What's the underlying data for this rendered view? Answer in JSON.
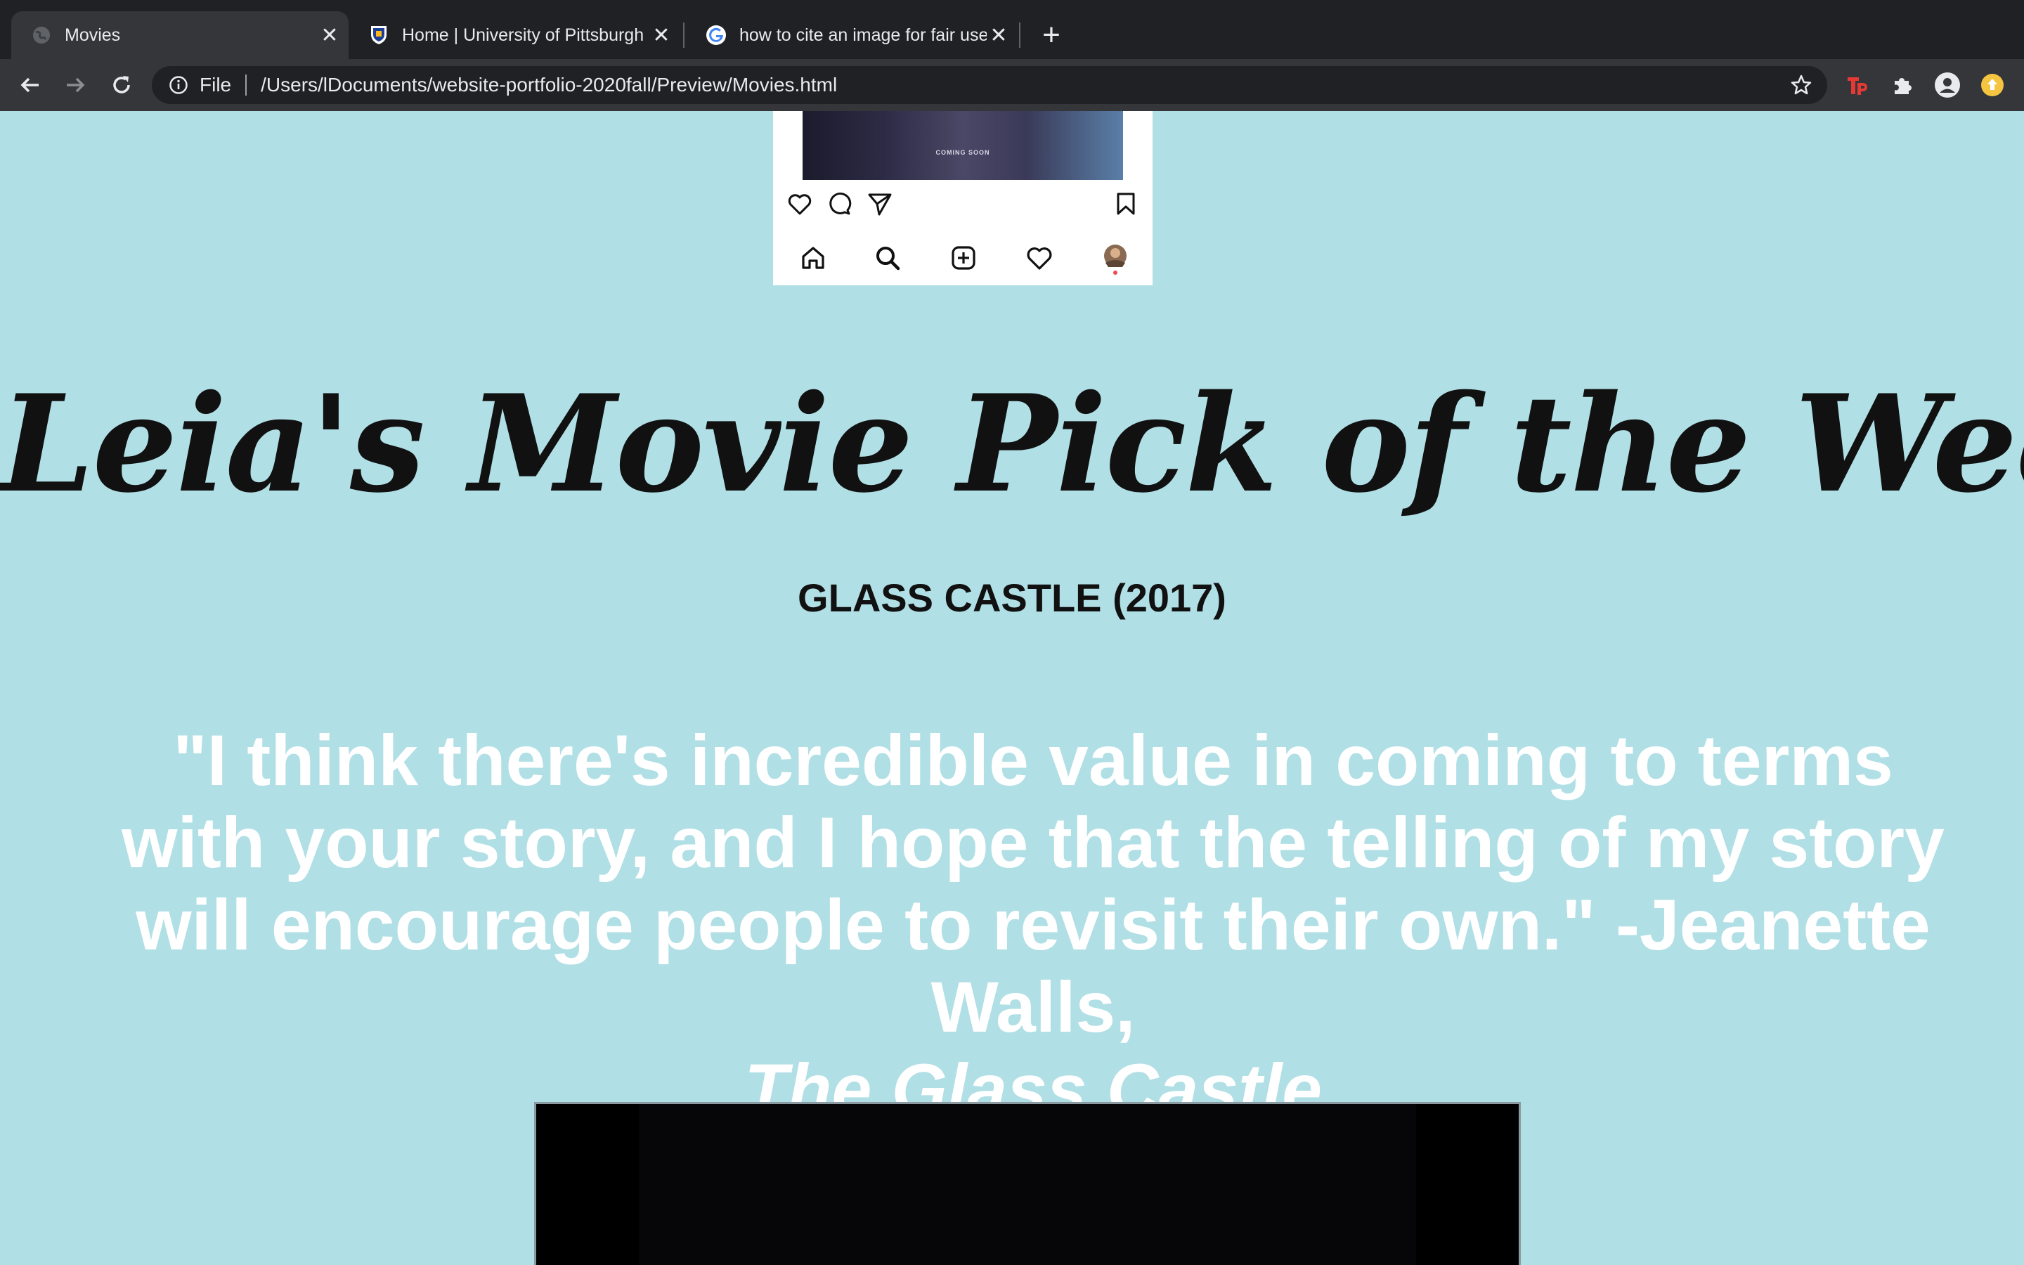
{
  "browser": {
    "tabs": [
      {
        "title": "Movies",
        "active": true,
        "favicon": "globe-icon"
      },
      {
        "title": "Home | University of Pittsburgh",
        "active": false,
        "favicon": "pitt-shield-icon"
      },
      {
        "title": "how to cite an image for fair use",
        "active": false,
        "favicon": "google-g-icon"
      }
    ],
    "new_tab_label": "+",
    "address": {
      "scheme_label": "File",
      "url": "/Users/lDocuments/website-portfolio-2020fall/Preview/Movies.html"
    },
    "extensions": [
      "tp-extension-icon",
      "puzzle-extensions-icon",
      "profile-icon",
      "update-indicator-icon"
    ]
  },
  "instagram_card": {
    "image_caption": "COMING SOON",
    "actions": [
      "heart-icon",
      "comment-icon",
      "share-icon",
      "bookmark-icon"
    ],
    "nav": [
      "home-icon",
      "search-icon",
      "new-post-icon",
      "activity-heart-icon",
      "profile-avatar-icon"
    ]
  },
  "main": {
    "heading": "Leia's Movie Pick of the Week",
    "movie": "GLASS CASTLE (2017)",
    "quote_text": "\"I think there's incredible value in coming to terms with your story, and I hope that the telling of my story will encourage people to revisit their own.\" -Jeanette Walls,",
    "quote_source": "The Glass Castle"
  },
  "colors": {
    "page_background": "#b0dfe5",
    "heading_text": "#111111",
    "quote_text": "#ffffff",
    "tabbar": "#202124",
    "toolbar": "#35363a"
  }
}
